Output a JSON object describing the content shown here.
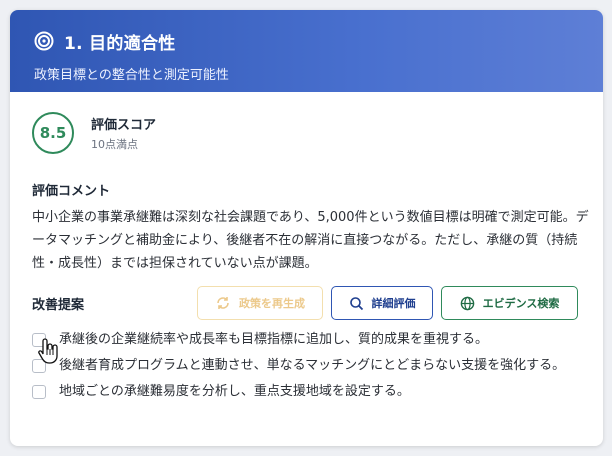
{
  "header": {
    "icon": "target-icon",
    "title": "1. 目的適合性",
    "subtitle": "政策目標との整合性と測定可能性"
  },
  "score": {
    "value": "8.5",
    "label": "評価スコア",
    "max_text": "10点満点",
    "color": "#2f8a5b"
  },
  "comment": {
    "title": "評価コメント",
    "text": "中小企業の事業承継難は深刻な社会課題であり、5,000件という数値目標は明確で測定可能。データマッチングと補助金により、後継者不在の解消に直接つながる。ただし、承継の質（持続性・成長性）までは担保されていない点が課題。"
  },
  "suggestions": {
    "title": "改善提案",
    "buttons": {
      "regenerate": "政策を再生成",
      "detail": "詳細評価",
      "evidence": "エビデンス検索"
    },
    "items": [
      "承継後の企業継続率や成長率も目標指標に追加し、質的成果を重視する。",
      "後継者育成プログラムと連動させ、単なるマッチングにとどまらない支援を強化する。",
      "地域ごとの承継難易度を分析し、重点支援地域を設定する。"
    ]
  },
  "colors": {
    "header_gradient_start": "#2f56b3",
    "header_gradient_end": "#5e7fd6",
    "green": "#2f8a5b",
    "blue": "#2f56b3",
    "regen_disabled": "#ecc98b"
  }
}
